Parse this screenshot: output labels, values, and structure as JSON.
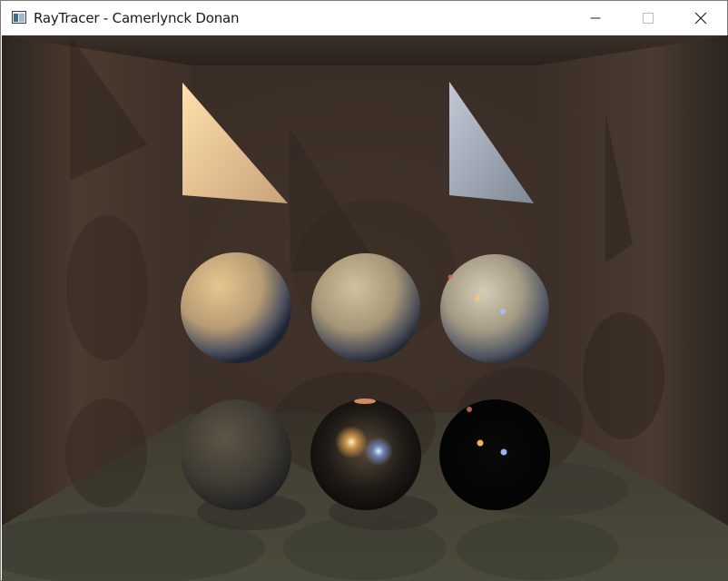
{
  "window": {
    "title": "RayTracer - Camerlynck Donan",
    "icons": {
      "app": "app-window-icon",
      "minimize": "minimize-icon",
      "maximize": "maximize-icon",
      "close": "close-icon"
    }
  },
  "scene": {
    "description_colors": {
      "wall": "#3a2e26",
      "floor": "#4a4236",
      "light_warm": "#f7d7a0",
      "light_cool": "#b8c6dc"
    }
  }
}
